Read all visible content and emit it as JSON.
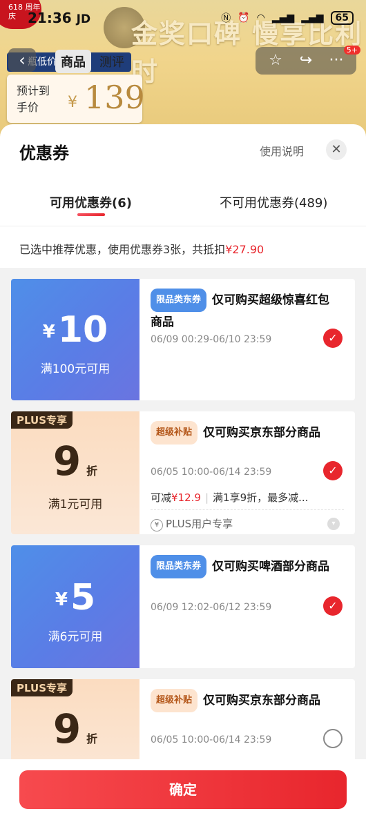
{
  "status": {
    "time": "21:36",
    "carrier_mark": "JD",
    "badge": "618\n周年庆",
    "battery": "65"
  },
  "background": {
    "banner": "金奖口碑 慢享比利时",
    "nav_tabs": [
      "商品",
      "测评"
    ],
    "promo_strip": "瓶低价",
    "price_label": "预计到手价",
    "price_currency": "¥",
    "price_value": "139",
    "message_count": "5+"
  },
  "sheet": {
    "title": "优惠券",
    "help": "使用说明",
    "tabs": [
      {
        "label": "可用优惠券(6)"
      },
      {
        "label": "不可用优惠券(489)"
      }
    ],
    "summary_prefix": "已选中推荐优惠，使用优惠券3张，共抵扣",
    "summary_amount": "¥27.90",
    "confirm": "确定"
  },
  "coupons": [
    {
      "amount_prefix": "¥",
      "amount": "10",
      "condition": "满100元可用",
      "tag": "限品类东券",
      "title": "仅可购买超级惊喜红包商品",
      "date": "06/09 00:29-06/10 23:59",
      "selected": true
    },
    {
      "plus": "PLUS专享",
      "amount": "9",
      "amount_suffix": "折",
      "condition": "满1元可用",
      "tag": "超级补贴",
      "title": "仅可购买京东部分商品",
      "date": "06/05 10:00-06/14 23:59",
      "extra_prefix": "可减",
      "extra_amount": "¥12.9",
      "extra_rest": "满1享9折，最多减...",
      "plus_note": "PLUS用户专享",
      "selected": true
    },
    {
      "amount_prefix": "¥",
      "amount": "5",
      "condition": "满6元可用",
      "tag": "限品类东券",
      "title": "仅可购买啤酒部分商品",
      "date": "06/09 12:02-06/12 23:59",
      "selected": true
    },
    {
      "plus": "PLUS专享",
      "amount": "9",
      "amount_suffix": "折",
      "condition": "",
      "tag": "超级补贴",
      "title": "仅可购买京东部分商品",
      "date": "06/05 10:00-06/14 23:59",
      "selected": false
    }
  ],
  "colors": {
    "accent": "#e8262d",
    "coupon_blue": "#4f8fe8",
    "coupon_peach": "#fbdcc0"
  }
}
